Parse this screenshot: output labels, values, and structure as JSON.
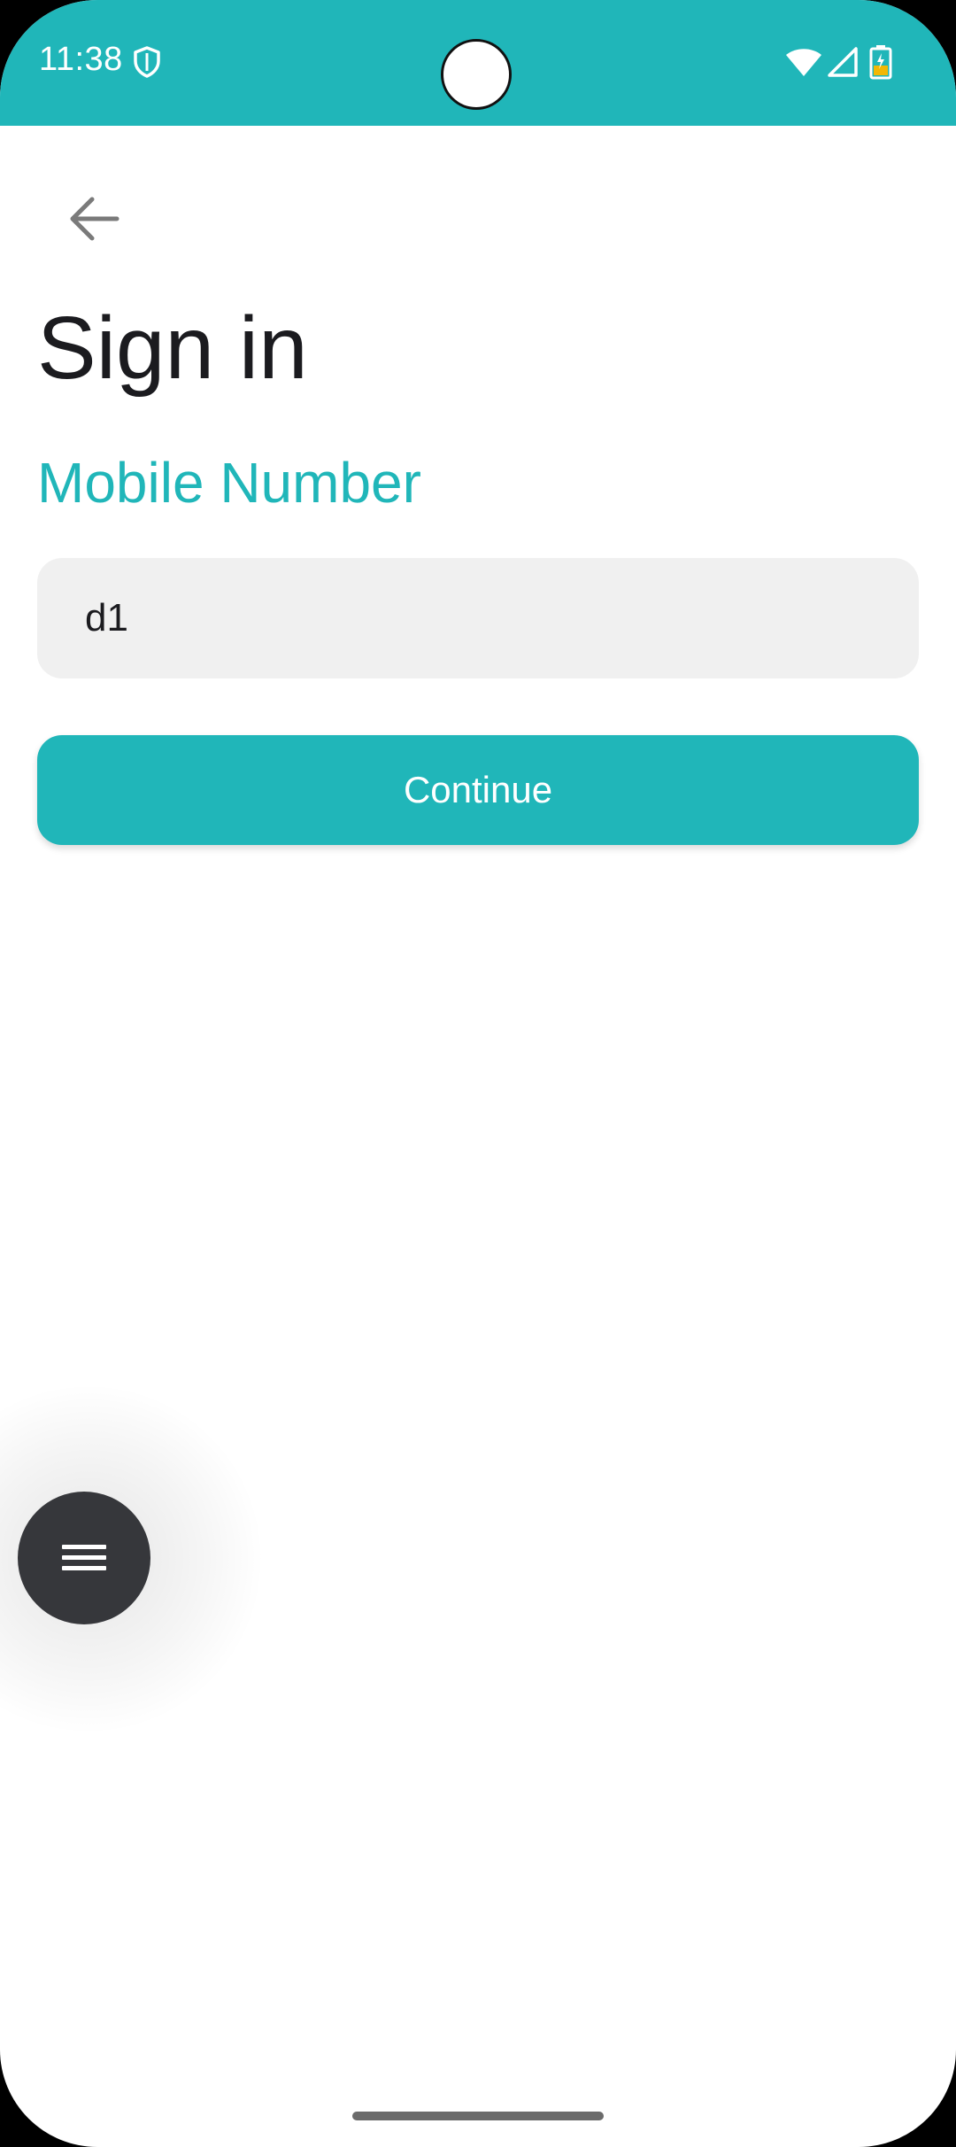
{
  "status_bar": {
    "time": "11:38",
    "background": "#20b6b9",
    "icons": [
      "shield-icon",
      "wifi-icon",
      "cell-signal-icon",
      "battery-charging-icon"
    ]
  },
  "header": {
    "back_icon": "arrow-left-icon",
    "title": "Sign in"
  },
  "form": {
    "mobile_label": "Mobile Number",
    "mobile_value": "d1",
    "continue_label": "Continue"
  },
  "fab": {
    "icon": "hamburger-menu-icon",
    "background": "#36373b"
  },
  "colors": {
    "accent": "#20b6b9",
    "input_background": "#f0f0f0",
    "title_text": "#1b1b1f"
  }
}
